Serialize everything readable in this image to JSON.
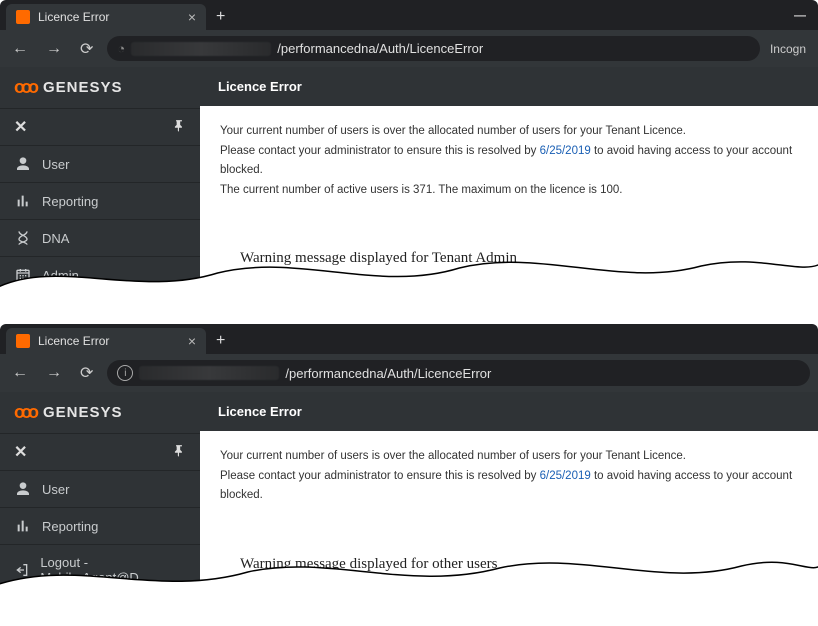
{
  "tab_title": "Licence Error",
  "url_path": "/performancedna/Auth/LicenceError",
  "incognito_label": "Incogn",
  "brand": "GENESYS",
  "sidebar": {
    "items_admin": [
      {
        "label": "User"
      },
      {
        "label": "Reporting"
      },
      {
        "label": "DNA"
      },
      {
        "label": "Admin"
      }
    ],
    "items_user": [
      {
        "label": "User"
      },
      {
        "label": "Reporting"
      },
      {
        "label": "Logout - Mobile.Agent@D..."
      }
    ]
  },
  "page": {
    "heading": "Licence Error",
    "msg_line1": "Your current number of users is over the allocated number of users for your Tenant Licence.",
    "msg_line2_prefix": "Please contact your administrator to ensure this is resolved by ",
    "msg_line2_date": "6/25/2019",
    "msg_line2_suffix": " to avoid having access to your account blocked.",
    "msg_line3": "The current number of active users is 371. The maximum on the licence is 100."
  },
  "captions": {
    "admin": "Warning message displayed for Tenant Admin",
    "user": "Warning message displayed for other users"
  }
}
